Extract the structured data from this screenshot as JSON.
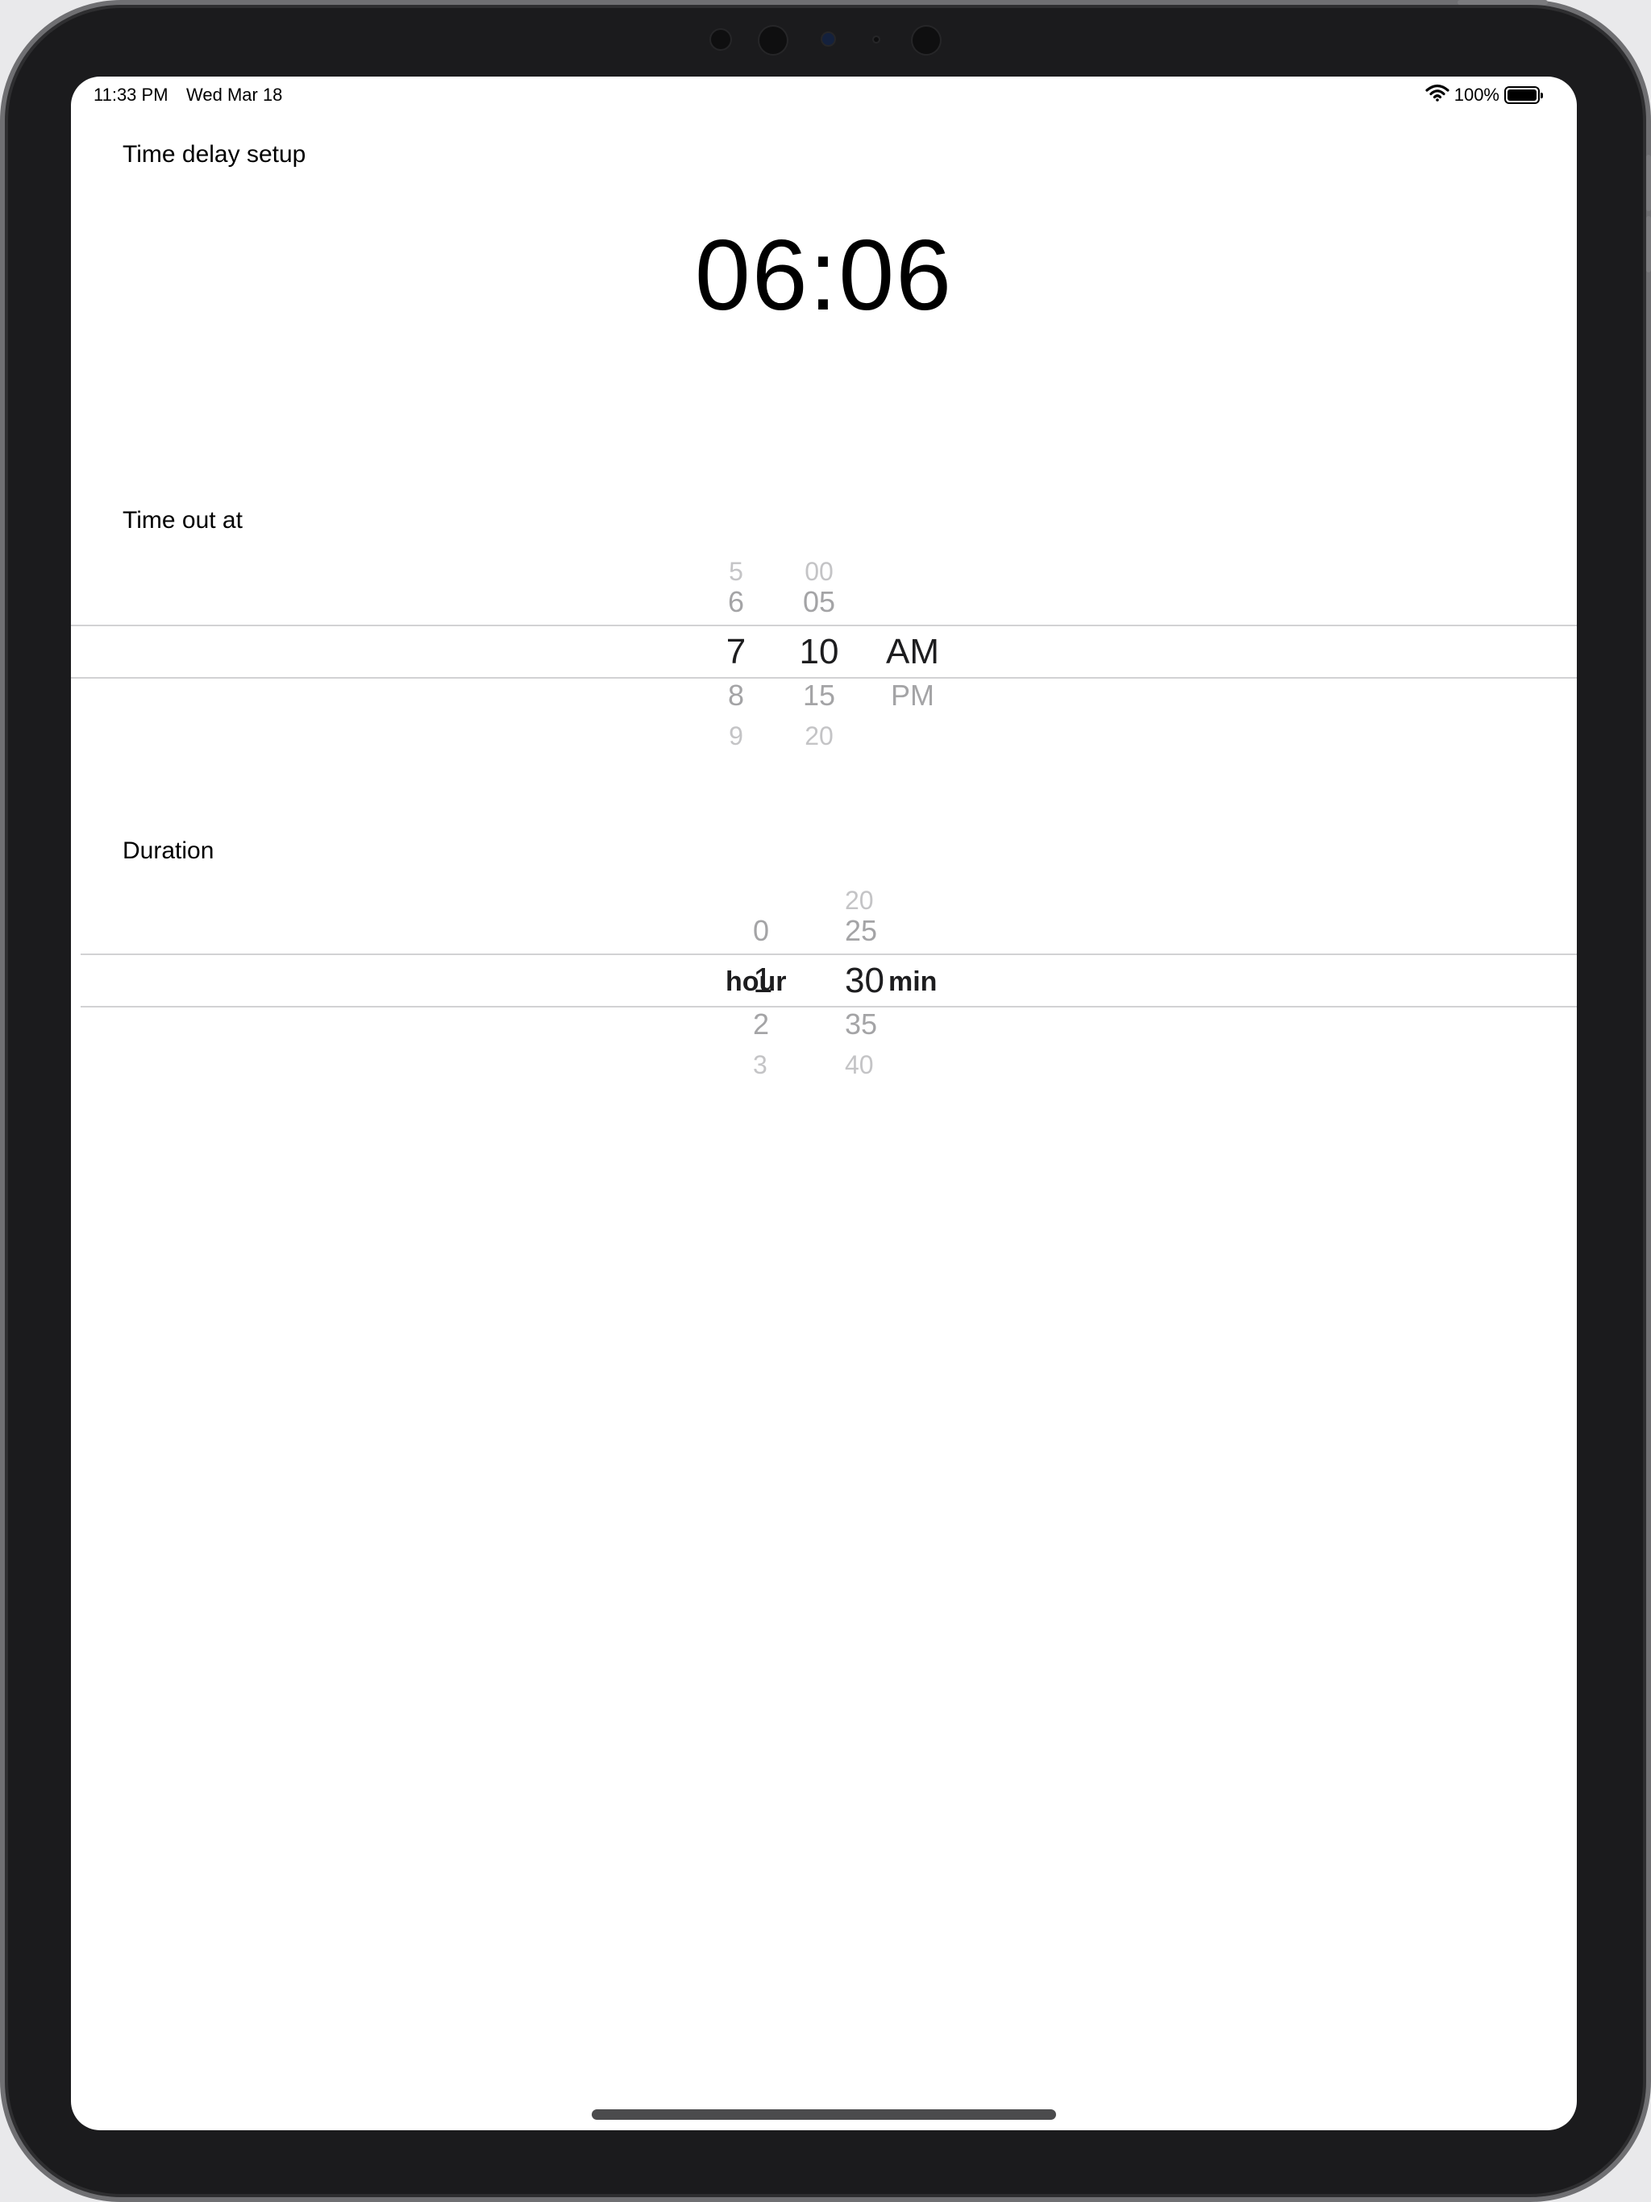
{
  "status_bar": {
    "time": "11:33 PM",
    "date": "Wed Mar 18",
    "battery_text": "100%",
    "battery_level": 1.0
  },
  "page": {
    "title": "Time delay setup",
    "clock": "06:06"
  },
  "timeout": {
    "label": "Time out at",
    "hours": {
      "far_above": "5",
      "above": "6",
      "selected": "7",
      "below": "8",
      "far_below": "9"
    },
    "minutes": {
      "far_above": "00",
      "above": "05",
      "selected": "10",
      "below": "15",
      "far_below": "20"
    },
    "period": {
      "selected": "AM",
      "below": "PM"
    }
  },
  "duration": {
    "label": "Duration",
    "hours": {
      "above": "0",
      "selected": "1",
      "below": "2",
      "far_below": "3"
    },
    "hours_unit": "hour",
    "minutes": {
      "far_above": "20",
      "above": "25",
      "selected": "30",
      "below": "35",
      "far_below": "40"
    },
    "minutes_unit": "min"
  },
  "colors": {
    "background": "#ffffff",
    "selection_line": "#d2d2d4",
    "selected_text": "#1d1d1f",
    "unselected_text": "#a4a4a6",
    "device_frame": "#1b1b1d"
  },
  "icons": {
    "wifi": "wifi-icon",
    "battery": "battery-icon"
  }
}
